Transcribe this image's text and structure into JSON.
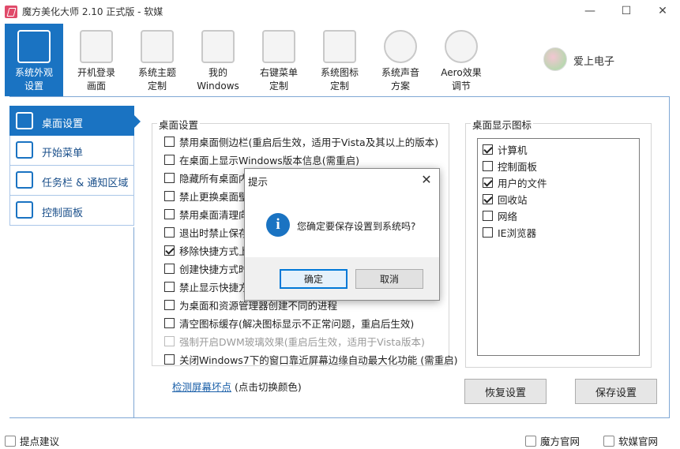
{
  "window": {
    "title": "魔方美化大师 2.10 正式版 - 软媒",
    "min_glyph": "—",
    "max_glyph": "☐",
    "close_glyph": "✕"
  },
  "toolbar": {
    "items": [
      {
        "label": "系统外观\n设置",
        "icon": "paintbrush-icon",
        "active": true
      },
      {
        "label": "开机登录\n画面",
        "icon": "user-screen-icon"
      },
      {
        "label": "系统主题\n定制",
        "icon": "shirt-icon"
      },
      {
        "label": "我的\nWindows",
        "icon": "window-icon"
      },
      {
        "label": "右键菜单\n定制",
        "icon": "cursor-icon"
      },
      {
        "label": "系统图标\n定制",
        "icon": "star-icon"
      },
      {
        "label": "系统声音\n方案",
        "icon": "music-note-icon"
      },
      {
        "label": "Aero效果\n调节",
        "icon": "aero-circle-icon"
      }
    ],
    "brand_name": "爱上电子"
  },
  "sidebar": {
    "items": [
      {
        "label": "桌面设置",
        "icon": "desktop-brush-icon",
        "active": true
      },
      {
        "label": "开始菜单",
        "icon": "start-menu-icon"
      },
      {
        "label": "任务栏 & 通知区域",
        "icon": "taskbar-icon"
      },
      {
        "label": "控制面板",
        "icon": "control-panel-icon"
      }
    ]
  },
  "desktop_settings": {
    "title": "桌面设置",
    "options": [
      {
        "label": "禁用桌面侧边栏(重启后生效，适用于Vista及其以上的版本)",
        "checked": false
      },
      {
        "label": "在桌面上显示Windows版本信息(需重启)",
        "checked": false
      },
      {
        "label": "隐藏所有桌面内",
        "checked": false
      },
      {
        "label": "禁止更换桌面壁",
        "checked": false
      },
      {
        "label": "禁用桌面清理向",
        "checked": false
      },
      {
        "label": "退出时禁止保存",
        "checked": false
      },
      {
        "label": "移除快捷方式上",
        "checked": true
      },
      {
        "label": "创建快捷方式时",
        "checked": false
      },
      {
        "label": "禁止显示快捷方",
        "checked": false
      },
      {
        "label": "为桌面和资源管理器创建不同的进程",
        "checked": false
      },
      {
        "label": "清空图标缓存(解决图标显示不正常问题，重启后生效)",
        "checked": false
      },
      {
        "label": "强制开启DWM玻璃效果(重启后生效，适用于Vista版本)",
        "checked": false,
        "disabled": true
      },
      {
        "label": "关闭Windows7下的窗口靠近屏幕边缘自动最大化功能 (需重启)",
        "checked": false
      }
    ]
  },
  "desktop_icons": {
    "title": "桌面显示图标",
    "items": [
      {
        "label": "计算机",
        "checked": true
      },
      {
        "label": "控制面板",
        "checked": false
      },
      {
        "label": "用户的文件",
        "checked": true
      },
      {
        "label": "回收站",
        "checked": true
      },
      {
        "label": "网络",
        "checked": false
      },
      {
        "label": "IE浏览器",
        "checked": false
      }
    ]
  },
  "footer_link": {
    "link_text": "检测屏幕坏点",
    "note": " (点击切换颜色)"
  },
  "buttons": {
    "restore": "恢复设置",
    "save": "保存设置"
  },
  "statusbar": {
    "feedback": "提点建议",
    "mofang_site": "魔方官网",
    "ruanmei_site": "软媒官网"
  },
  "dialog": {
    "title": "提示",
    "close_glyph": "✕",
    "icon_glyph": "i",
    "message": "您确定要保存设置到系统吗?",
    "ok": "确定",
    "cancel": "取消"
  },
  "colors": {
    "accent": "#1a73c2",
    "link": "#1a5fa8",
    "panel_border": "#7fa7d4"
  }
}
